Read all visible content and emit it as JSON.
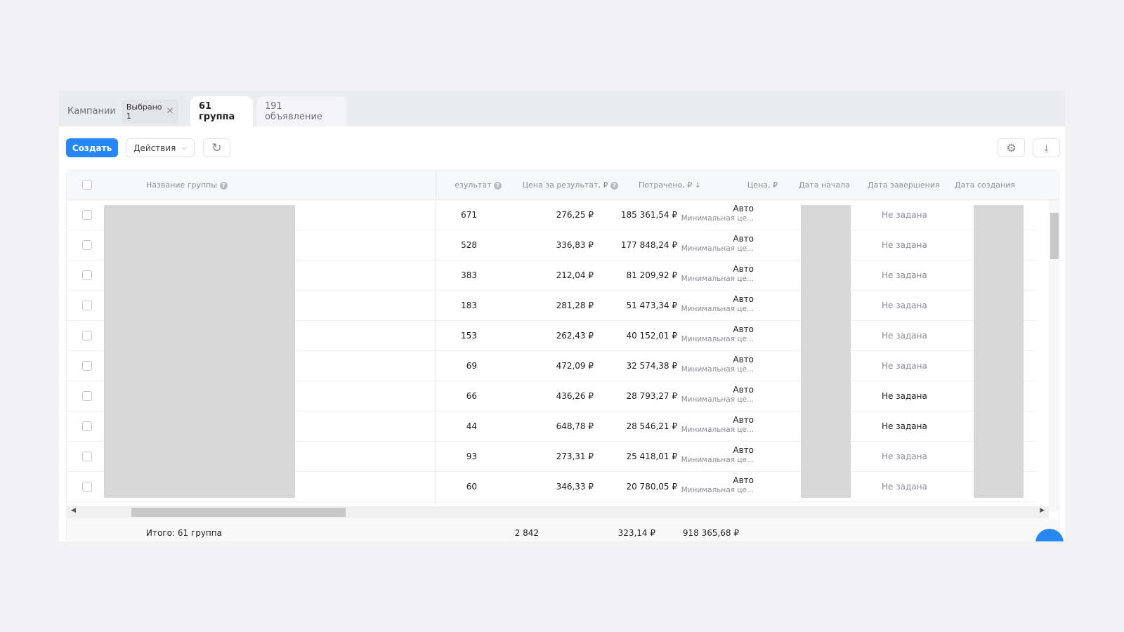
{
  "tabs": {
    "campaigns": "Кампании",
    "selected_chip": "Выбрано 1",
    "groups": "61 группа",
    "ads": "191 объявление"
  },
  "toolbar": {
    "create": "Создать",
    "actions": "Действия"
  },
  "columns": {
    "name": "Название группы",
    "result": "Результат",
    "cost_per_result": "Цена за результат, ₽",
    "spent": "Потрачено, ₽ ↓",
    "price": "Цена, ₽",
    "start": "Дата начала",
    "end": "Дата завершения",
    "created": "Дата создания"
  },
  "rows": [
    {
      "result": "671",
      "cpr": "276,25 ₽",
      "spent": "185 361,54 ₽",
      "price": "Авто",
      "price_sub": "Минимальная це...",
      "end": "Не задана"
    },
    {
      "result": "528",
      "cpr": "336,83 ₽",
      "spent": "177 848,24 ₽",
      "price": "Авто",
      "price_sub": "Минимальная це...",
      "end": "Не задана"
    },
    {
      "result": "383",
      "cpr": "212,04 ₽",
      "spent": "81 209,92 ₽",
      "price": "Авто",
      "price_sub": "Минимальная це...",
      "end": "Не задана"
    },
    {
      "result": "183",
      "cpr": "281,28 ₽",
      "spent": "51 473,34 ₽",
      "price": "Авто",
      "price_sub": "Минимальная це...",
      "end": "Не задана"
    },
    {
      "result": "153",
      "cpr": "262,43 ₽",
      "spent": "40 152,01 ₽",
      "price": "Авто",
      "price_sub": "Минимальная це...",
      "end": "Не задана"
    },
    {
      "result": "69",
      "cpr": "472,09 ₽",
      "spent": "32 574,38 ₽",
      "price": "Авто",
      "price_sub": "Минимальная це...",
      "end": "Не задана"
    },
    {
      "result": "66",
      "cpr": "436,26 ₽",
      "spent": "28 793,27 ₽",
      "price": "Авто",
      "price_sub": "Минимальная це...",
      "end": "Не задана"
    },
    {
      "result": "44",
      "cpr": "648,78 ₽",
      "spent": "28 546,21 ₽",
      "price": "Авто",
      "price_sub": "Минимальная це...",
      "end": "Не задана"
    },
    {
      "result": "93",
      "cpr": "273,31 ₽",
      "spent": "25 418,01 ₽",
      "price": "Авто",
      "price_sub": "Минимальная це...",
      "end": "Не задана"
    },
    {
      "result": "60",
      "cpr": "346,33 ₽",
      "spent": "20 780,05 ₽",
      "price": "Авто",
      "price_sub": "Минимальная це...",
      "end": "Не задана"
    }
  ],
  "totals": {
    "label": "Итого: 61 группа",
    "result": "2 842",
    "cpr": "323,14 ₽",
    "spent": "918 365,68 ₽"
  },
  "accent": "#2787f5"
}
